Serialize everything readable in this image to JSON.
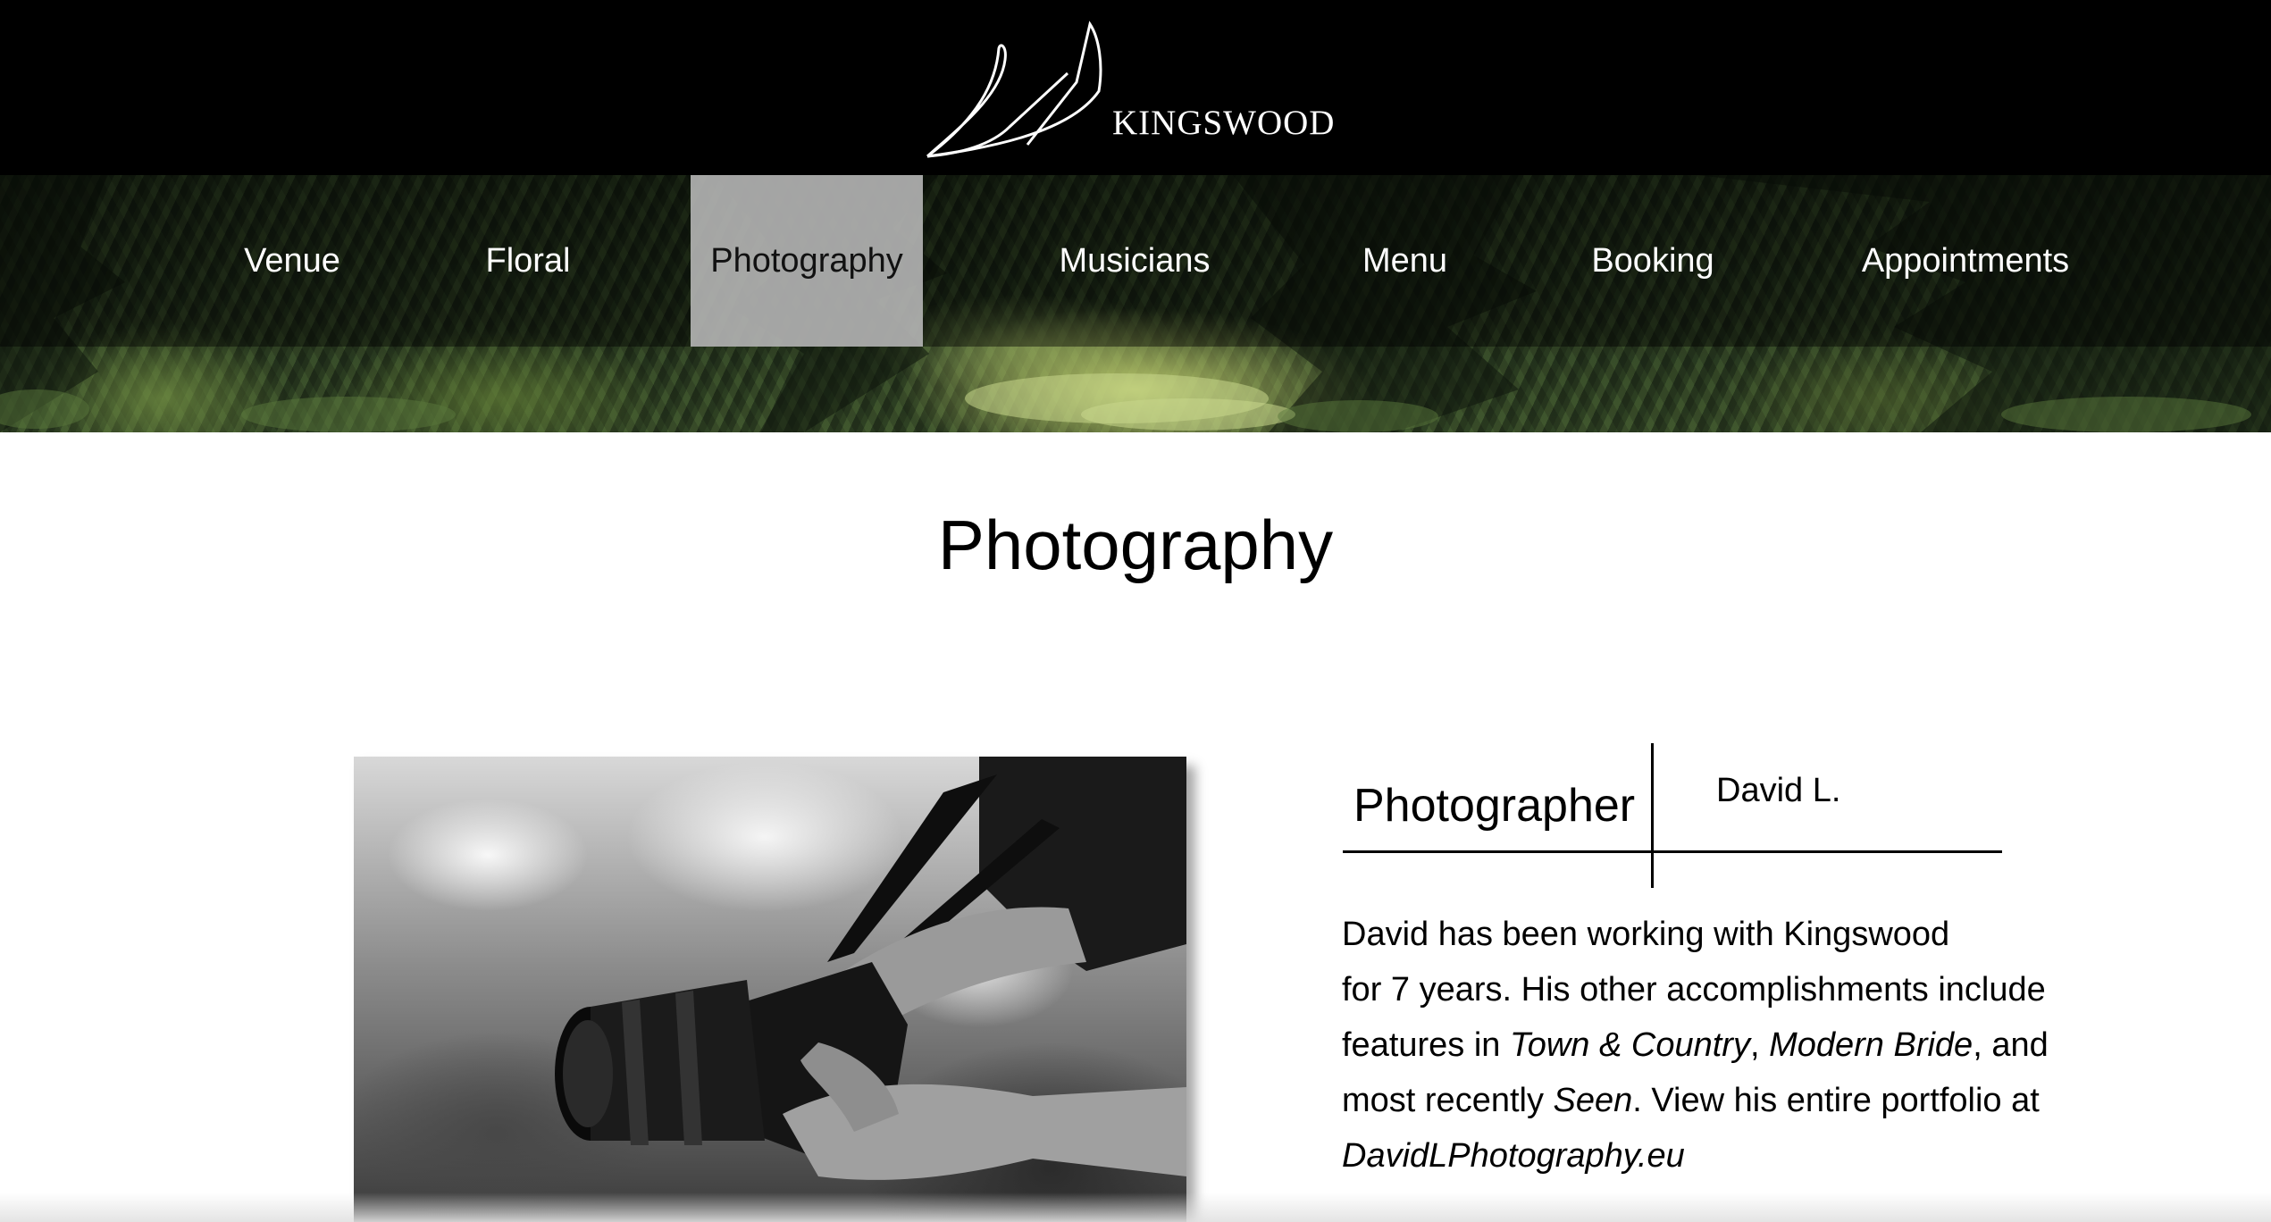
{
  "header": {
    "brand": "KINGSWOOD"
  },
  "nav": {
    "items": [
      {
        "label": "Venue",
        "active": false
      },
      {
        "label": "Floral",
        "active": false
      },
      {
        "label": "Photography",
        "active": true
      },
      {
        "label": "Musicians",
        "active": false
      },
      {
        "label": "Menu",
        "active": false
      },
      {
        "label": "Booking",
        "active": false
      },
      {
        "label": "Appointments",
        "active": false
      }
    ]
  },
  "main": {
    "title": "Photography",
    "profile": {
      "label": "Photographer",
      "name": "David L."
    },
    "bio": {
      "line1": "David has been working with Kingswood",
      "line2": "for 7 years. His other accomplishments include",
      "line3_a": "features in ",
      "line3_em1": "Town & Country",
      "line3_b": ", ",
      "line3_em2": "Modern Bride",
      "line3_c": ", and",
      "line4_a": "most recently ",
      "line4_em": "Seen",
      "line4_b": ". View his entire portfolio at",
      "line5_em": "DavidLPhotography.eu"
    }
  },
  "colors": {
    "header_bg": "#000000",
    "nav_active_bg": "#b9b9b9",
    "text": "#000000",
    "nav_text": "#ffffff"
  }
}
